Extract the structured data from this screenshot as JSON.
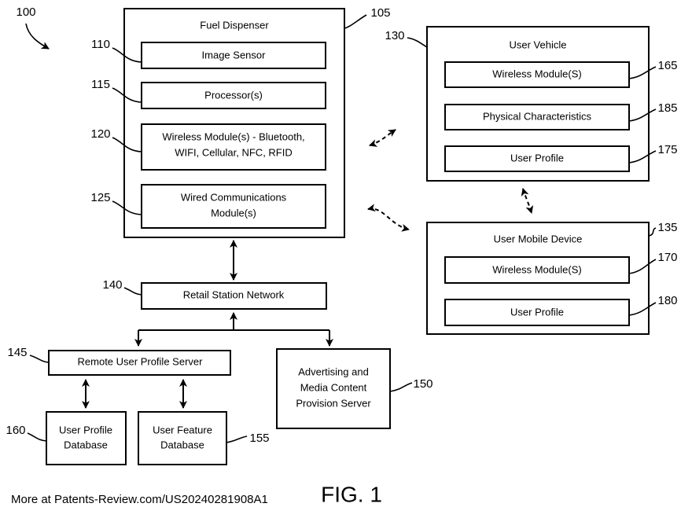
{
  "figure": {
    "caption": "FIG. 1",
    "footer": "More at Patents-Review.com/US20240281908A1",
    "system_ref": "100"
  },
  "nodes": {
    "fuel_dispenser": {
      "ref": "105",
      "title": "Fuel Dispenser",
      "modules": [
        {
          "ref": "110",
          "label": "Image Sensor"
        },
        {
          "ref": "115",
          "label": "Processor(s)"
        },
        {
          "ref": "120",
          "label_line1": "Wireless Module(s) - Bluetooth,",
          "label_line2": "WIFI, Cellular, NFC, RFID"
        },
        {
          "ref": "125",
          "label_line1": "Wired Communications",
          "label_line2": "Module(s)"
        }
      ]
    },
    "user_vehicle": {
      "ref": "130",
      "title": "User Vehicle",
      "modules": [
        {
          "ref": "165",
          "label": "Wireless Module(S)"
        },
        {
          "ref": "185",
          "label": "Physical Characteristics"
        },
        {
          "ref": "175",
          "label": "User Profile"
        }
      ]
    },
    "user_mobile_device": {
      "ref": "135",
      "title": "User Mobile Device",
      "modules": [
        {
          "ref": "170",
          "label": "Wireless Module(S)"
        },
        {
          "ref": "180",
          "label": "User Profile"
        }
      ]
    },
    "retail_station_network": {
      "ref": "140",
      "label": "Retail Station Network"
    },
    "remote_user_profile_server": {
      "ref": "145",
      "label": "Remote User Profile Server"
    },
    "advertising_server": {
      "ref": "150",
      "label_line1": "Advertising and",
      "label_line2": "Media Content",
      "label_line3": "Provision Server"
    },
    "user_profile_database": {
      "ref": "160",
      "label_line1": "User Profile",
      "label_line2": "Database"
    },
    "user_feature_database": {
      "ref": "155",
      "label_line1": "User Feature",
      "label_line2": "Database"
    }
  },
  "colors": {
    "stroke": "#000000",
    "fill": "#ffffff"
  }
}
